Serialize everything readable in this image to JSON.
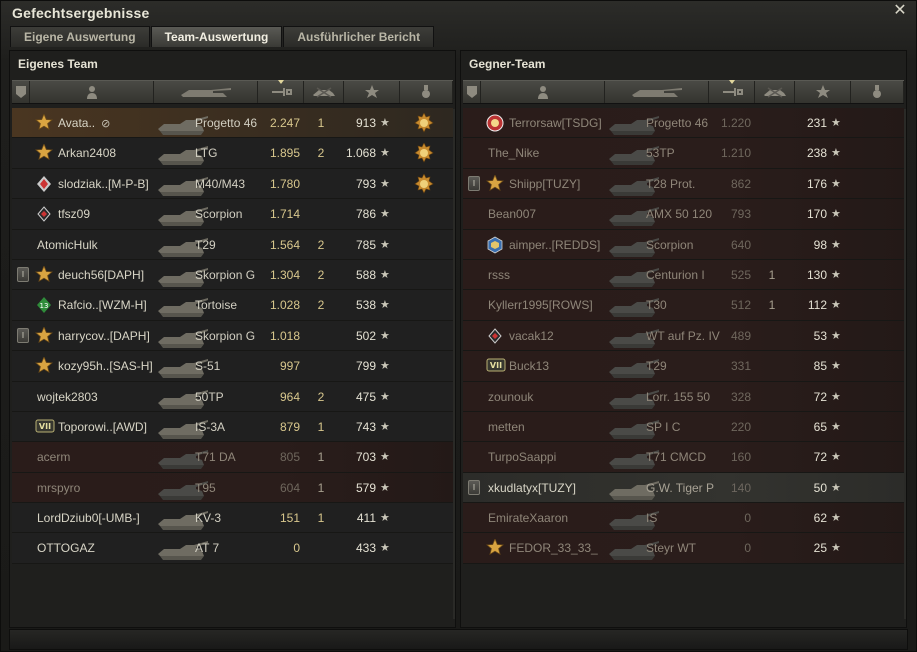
{
  "window": {
    "title": "Gefechtsergebnisse",
    "close_icon": "close-icon"
  },
  "tabs": [
    {
      "label": "Eigene Auswertung",
      "active": false
    },
    {
      "label": "Team-Auswertung",
      "active": true
    },
    {
      "label": "Ausführlicher Bericht",
      "active": false
    }
  ],
  "left_team": {
    "title": "Eigenes Team",
    "rows": [
      {
        "name": "Avata..",
        "vision": "👁",
        "badge": "gold-star",
        "tank": "Progetto 46",
        "damage": "2.247",
        "kills": "1",
        "xp": "913",
        "medal": "medal-orange",
        "state": "self"
      },
      {
        "name": "Arkan2408",
        "badge": "gold-star",
        "tank": "LTG",
        "damage": "1.895",
        "kills": "2",
        "xp": "1.068",
        "medal": "medal-orange",
        "state": "alive"
      },
      {
        "name": "slodziak..[M-P-B]",
        "badge": "red-crest",
        "tank": "M40/M43",
        "damage": "1.780",
        "kills": "",
        "xp": "793",
        "medal": "medal-orange",
        "state": "alive"
      },
      {
        "name": "tfsz09",
        "badge": "red-diamond",
        "tank": "Scorpion",
        "damage": "1.714",
        "kills": "",
        "xp": "786",
        "medal": "",
        "state": "alive"
      },
      {
        "name": "AtomicHulk",
        "badge": "",
        "tank": "T29",
        "damage": "1.564",
        "kills": "2",
        "xp": "785",
        "medal": "",
        "state": "alive"
      },
      {
        "name": "deuch56[DAPH]",
        "platoon": true,
        "badge": "gold-star",
        "tank": "Skorpion G",
        "damage": "1.304",
        "kills": "2",
        "xp": "588",
        "medal": "",
        "state": "alive"
      },
      {
        "name": "Rafcio..[WZM-H]",
        "badge": "green-13",
        "tank": "Tortoise",
        "damage": "1.028",
        "kills": "2",
        "xp": "538",
        "medal": "",
        "state": "alive"
      },
      {
        "name": "harrycov..[DAPH]",
        "platoon": true,
        "badge": "gold-star",
        "tank": "Skorpion G",
        "damage": "1.018",
        "kills": "",
        "xp": "502",
        "medal": "",
        "state": "alive"
      },
      {
        "name": "kozy95h..[SAS-H]",
        "badge": "gold-star",
        "tank": "S-51",
        "damage": "997",
        "kills": "",
        "xp": "799",
        "medal": "",
        "state": "alive"
      },
      {
        "name": "wojtek2803",
        "badge": "",
        "tank": "50TP",
        "damage": "964",
        "kills": "2",
        "xp": "475",
        "medal": "",
        "state": "alive"
      },
      {
        "name": "Toporowi..[AWD]",
        "badge": "vii",
        "tank": "IS-3A",
        "damage": "879",
        "kills": "1",
        "xp": "743",
        "medal": "",
        "state": "alive"
      },
      {
        "name": "acerm",
        "badge": "",
        "tank": "T71 DA",
        "damage": "805",
        "kills": "1",
        "xp": "703",
        "medal": "",
        "state": "dead"
      },
      {
        "name": "mrspyro",
        "badge": "",
        "tank": "T95",
        "damage": "604",
        "kills": "1",
        "xp": "579",
        "medal": "",
        "state": "dead"
      },
      {
        "name": "LordDziub0[-UMB-]",
        "badge": "",
        "tank": "KV-3",
        "damage": "151",
        "kills": "1",
        "xp": "411",
        "medal": "",
        "state": "alive"
      },
      {
        "name": "OTTOGAZ",
        "badge": "",
        "tank": "AT 7",
        "damage": "0",
        "kills": "",
        "xp": "433",
        "medal": "",
        "state": "alive"
      }
    ]
  },
  "right_team": {
    "title": "Gegner-Team",
    "rows": [
      {
        "name": "Terrorsaw[TSDG]",
        "badge": "red-ring",
        "tank": "Progetto 46",
        "damage": "1.220",
        "kills": "",
        "xp": "231",
        "state": "dead"
      },
      {
        "name": "The_Nike",
        "badge": "",
        "tank": "53TP",
        "damage": "1.210",
        "kills": "",
        "xp": "238",
        "state": "dead"
      },
      {
        "name": "Shiipp[TUZY]",
        "platoon": true,
        "badge": "gold-star",
        "tank": "T28 Prot.",
        "damage": "862",
        "kills": "",
        "xp": "176",
        "state": "dead"
      },
      {
        "name": "Bean007",
        "badge": "",
        "tank": "AMX 50 120",
        "damage": "793",
        "kills": "",
        "xp": "170",
        "state": "dead"
      },
      {
        "name": "aimper..[REDDS]",
        "badge": "blue-cube",
        "tank": "Scorpion",
        "damage": "640",
        "kills": "",
        "xp": "98",
        "state": "dead"
      },
      {
        "name": "rsss",
        "badge": "",
        "tank": "Centurion I",
        "damage": "525",
        "kills": "1",
        "xp": "130",
        "state": "dead"
      },
      {
        "name": "Kyllerr1995[ROWS]",
        "badge": "",
        "tank": "T30",
        "damage": "512",
        "kills": "1",
        "xp": "112",
        "state": "dead"
      },
      {
        "name": "vacak12",
        "badge": "red-diamond",
        "tank": "WT auf Pz. IV",
        "damage": "489",
        "kills": "",
        "xp": "53",
        "state": "dead"
      },
      {
        "name": "Buck13",
        "badge": "vii",
        "tank": "T29",
        "damage": "331",
        "kills": "",
        "xp": "85",
        "state": "dead"
      },
      {
        "name": "zounouk",
        "badge": "",
        "tank": "Lorr. 155 50",
        "damage": "328",
        "kills": "",
        "xp": "72",
        "state": "dead"
      },
      {
        "name": "metten",
        "badge": "",
        "tank": "SP I C",
        "damage": "220",
        "kills": "",
        "xp": "65",
        "state": "dead"
      },
      {
        "name": "TurpoSaappi",
        "badge": "",
        "tank": "T71 CMCD",
        "damage": "160",
        "kills": "",
        "xp": "72",
        "state": "dead"
      },
      {
        "name": "xkudlatyx[TUZY]",
        "platoon": true,
        "badge": "",
        "tank": "G.W. Tiger P",
        "damage": "140",
        "kills": "",
        "xp": "50",
        "state": "highlight"
      },
      {
        "name": "EmirateXaaron",
        "badge": "",
        "tank": "IS",
        "damage": "0",
        "kills": "",
        "xp": "62",
        "state": "dead"
      },
      {
        "name": "FEDOR_33_33_",
        "badge": "gold-star",
        "tank": "Steyr WT",
        "damage": "0",
        "kills": "",
        "xp": "25",
        "state": "dead"
      }
    ]
  },
  "header_icons": [
    "platoon-icon",
    "player-icon",
    "tank-icon",
    "damage-icon",
    "kills-icon",
    "xp-star-icon",
    "medal-icon"
  ],
  "colors": {
    "accent": "#d8c78d",
    "dead_row": "#2a1c1a",
    "self_row": "#4a3621"
  }
}
